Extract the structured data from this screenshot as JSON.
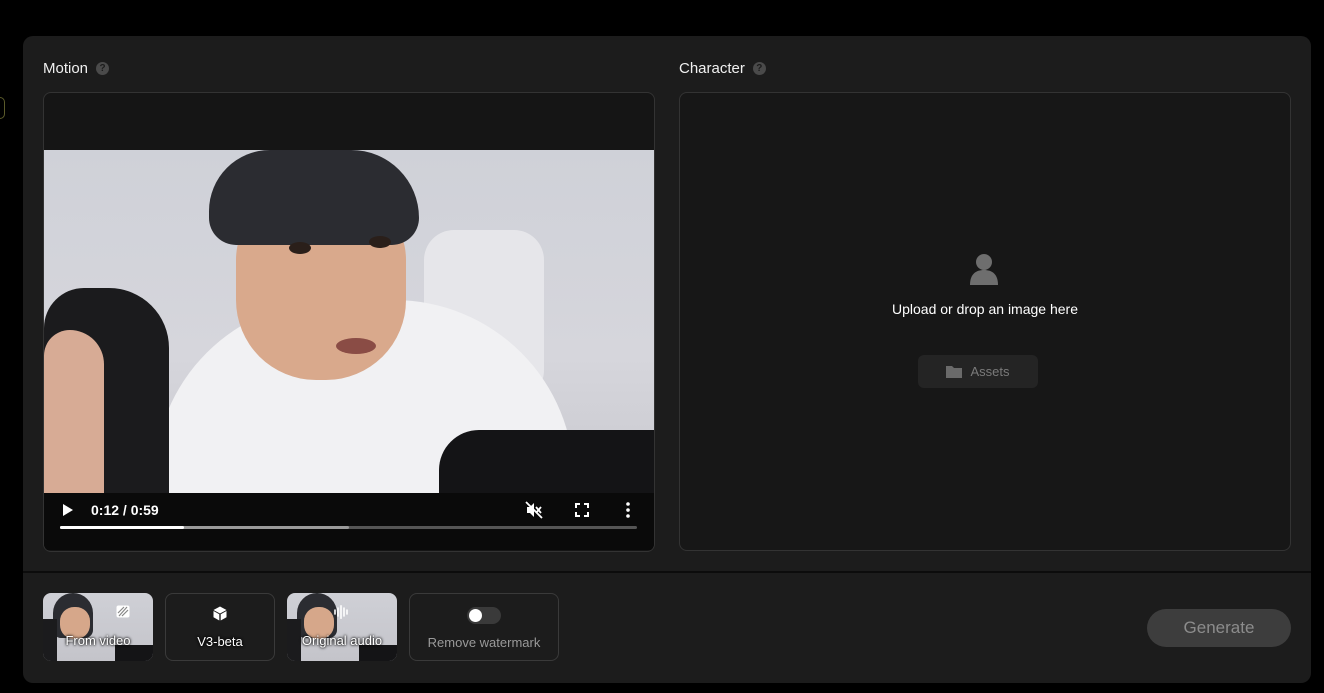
{
  "motion": {
    "label": "Motion"
  },
  "character": {
    "label": "Character",
    "upload_text": "Upload or drop an image here",
    "assets_label": "Assets"
  },
  "player": {
    "time": "0:12 / 0:59",
    "played_fraction": 0.215,
    "buffered_fraction": 0.5
  },
  "options": {
    "from_video": "From video",
    "model": "V3-beta",
    "original_audio": "Original audio",
    "remove_watermark": "Remove watermark",
    "remove_watermark_enabled": false
  },
  "generate_label": "Generate",
  "icons": [
    "help-icon",
    "play-icon",
    "mute-icon",
    "fullscreen-icon",
    "more-icon",
    "user-icon",
    "folder-icon",
    "video-icon",
    "cube-icon",
    "audio-wave-icon"
  ]
}
